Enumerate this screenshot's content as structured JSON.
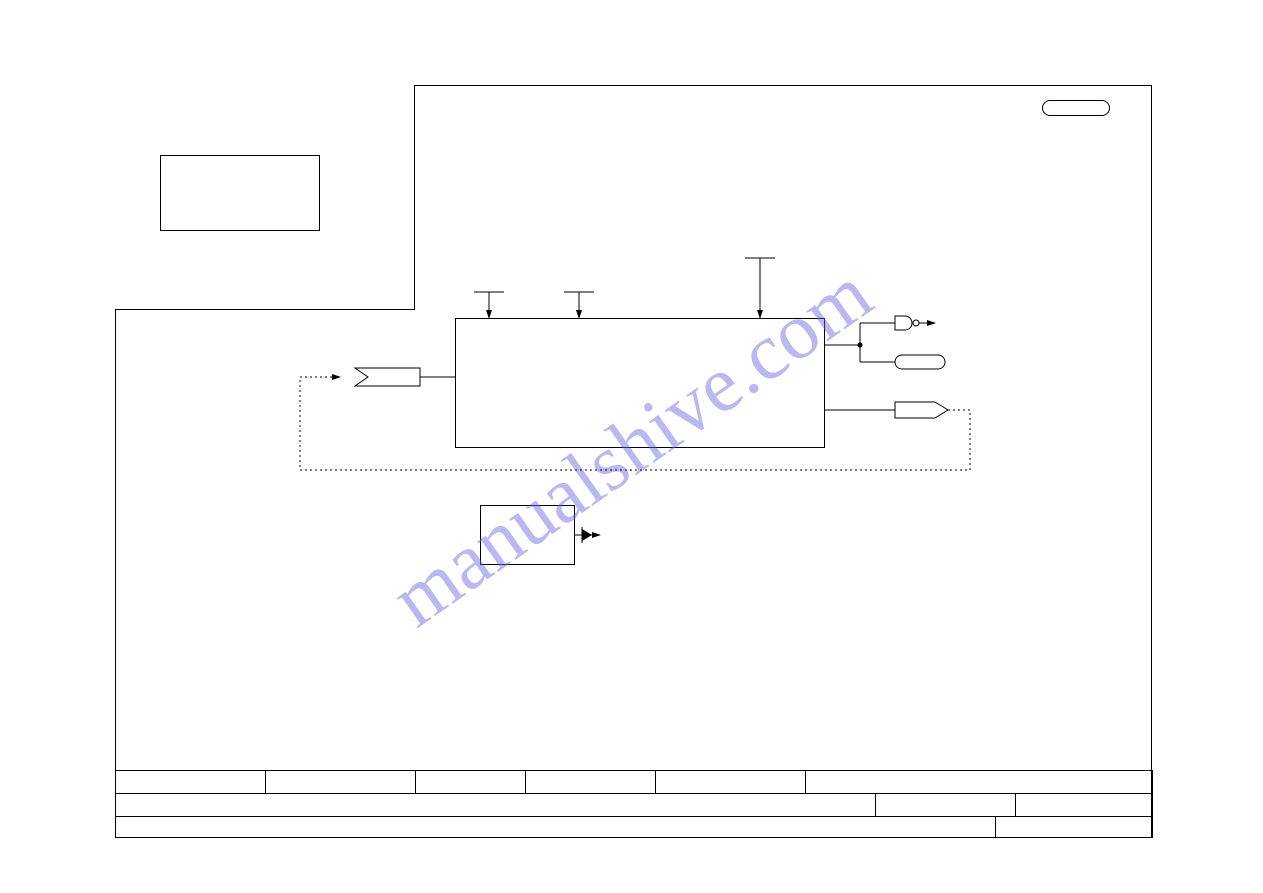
{
  "watermark": "manualshive.com"
}
